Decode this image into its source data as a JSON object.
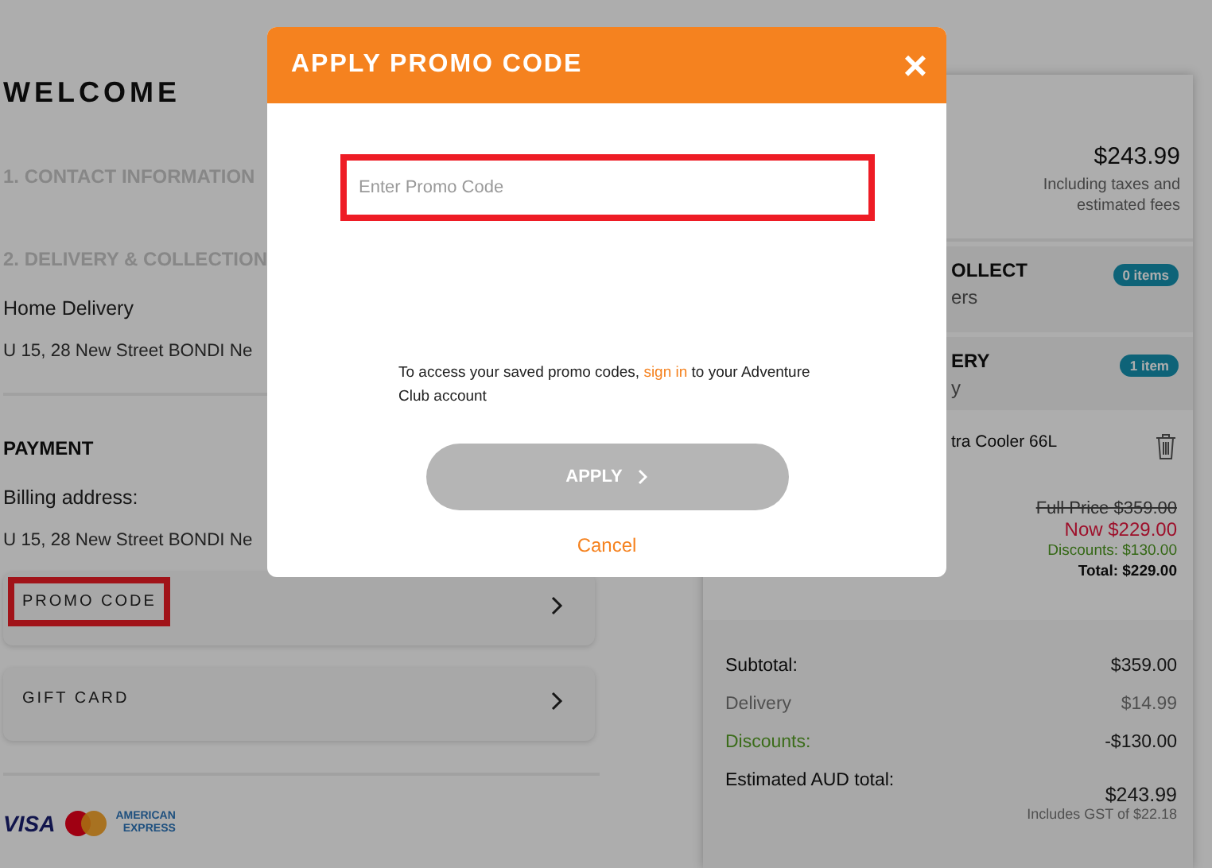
{
  "page": {
    "title": "WELCOME",
    "sections": [
      {
        "heading": "1. CONTACT INFORMATION"
      },
      {
        "heading": "2. DELIVERY & COLLECTION",
        "lines": [
          "Home Delivery",
          "U 15, 28 New Street BONDI Ne"
        ]
      }
    ],
    "payment": {
      "heading": "PAYMENT",
      "billing_label": "Billing address:",
      "billing_address": "U 15, 28 New Street BONDI Ne"
    },
    "options": [
      {
        "label": "PROMO CODE",
        "highlighted": true
      },
      {
        "label": "GIFT CARD",
        "highlighted": false
      }
    ],
    "payment_logos": [
      {
        "kind": "visa",
        "lines": [
          "VISA"
        ]
      },
      {
        "kind": "mastercard"
      },
      {
        "kind": "amex",
        "lines": [
          "AMERICAN",
          "EXPRESS"
        ]
      }
    ]
  },
  "summary": {
    "total": "$243.99",
    "total_note": "Including taxes and estimated fees",
    "groups": [
      {
        "title": "OLLECT",
        "subtitle": "ers",
        "badge": "0 items"
      },
      {
        "title": "ERY",
        "subtitle": "y",
        "badge": "1 item"
      }
    ],
    "product": {
      "name": "tra Cooler 66L",
      "prices": [
        {
          "kind": "was",
          "text": "Full Price $359.00"
        },
        {
          "kind": "now",
          "text": "Now $229.00"
        },
        {
          "kind": "discount",
          "text": "Discounts: $130.00"
        },
        {
          "kind": "total",
          "text": "Total: $229.00"
        }
      ]
    },
    "rows": [
      {
        "kind": "main",
        "label": "Subtotal:",
        "value": "$359.00"
      },
      {
        "kind": "muted",
        "label": "Delivery",
        "value": "$14.99"
      },
      {
        "kind": "discount",
        "label": "Discounts:",
        "value": "-$130.00"
      },
      {
        "kind": "grand",
        "label": "Estimated AUD total:",
        "value": "$243.99",
        "note": "Includes GST of $22.18"
      }
    ]
  },
  "modal": {
    "title": "APPLY PROMO CODE",
    "close": "×",
    "field": {
      "placeholder": "Enter Promo Code",
      "highlighted": true
    },
    "message": {
      "before": "To access your saved promo codes, ",
      "link": "sign in",
      "after": "  to your Adventure Club account"
    },
    "apply": {
      "label": "APPLY",
      "disabled": true
    },
    "cancel": "Cancel"
  }
}
